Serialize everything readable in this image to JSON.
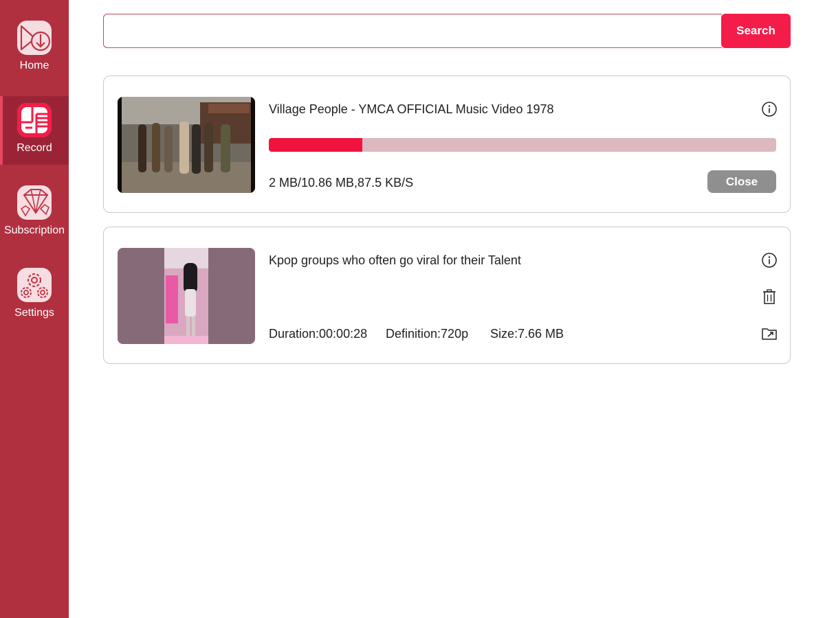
{
  "sidebar": {
    "items": [
      {
        "label": "Home",
        "icon": "download-video-icon"
      },
      {
        "label": "Record",
        "icon": "record-list-icon",
        "active": true
      },
      {
        "label": "Subscription",
        "icon": "diamond-icon"
      },
      {
        "label": "Settings",
        "icon": "gear-icon"
      }
    ]
  },
  "search": {
    "value": "",
    "button_label": "Search"
  },
  "downloads": [
    {
      "title": "Village People - YMCA OFFICIAL Music Video 1978",
      "progress_text": "2 MB/10.86 MB,87.5 KB/S",
      "progress_fraction": 0.184,
      "close_label": "Close"
    },
    {
      "title": "Kpop groups who often go viral for their Talent",
      "duration": "Duration:00:00:28",
      "definition": "Definition:720p",
      "size": "Size:7.66 MB"
    }
  ],
  "colors": {
    "sidebar": "#b03040",
    "accent": "#f41c48",
    "progress_track": "#dcb8bf"
  }
}
